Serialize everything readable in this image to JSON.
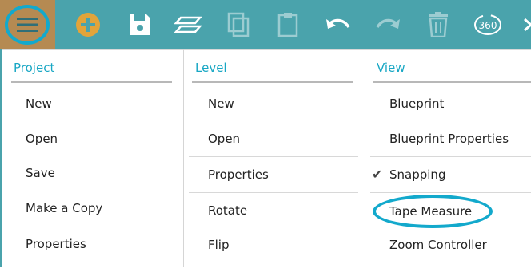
{
  "toolbar": {
    "buttons": [
      {
        "icon": "hamburger-menu-icon",
        "active": true
      },
      {
        "icon": "add-circle-icon"
      },
      {
        "icon": "save-icon"
      },
      {
        "icon": "layers-icon"
      },
      {
        "icon": "copy-icon"
      },
      {
        "icon": "paste-icon"
      },
      {
        "icon": "undo-icon"
      },
      {
        "icon": "redo-icon"
      },
      {
        "icon": "trash-icon"
      },
      {
        "icon": "view-360-icon",
        "label": "360"
      }
    ],
    "colors": {
      "bar": "#4aa3ac",
      "menu_cell": "#b58a52",
      "add_icon": "#e2a43a",
      "highlight_ring": "#13a9cc"
    }
  },
  "menu": {
    "project": {
      "header": "Project",
      "items": [
        "New",
        "Open",
        "Save",
        "Make a Copy",
        "Properties"
      ]
    },
    "level": {
      "header": "Level",
      "items": [
        "New",
        "Open",
        "Properties",
        "Rotate",
        "Flip"
      ]
    },
    "view": {
      "header": "View",
      "items": [
        "Blueprint",
        "Blueprint Properties",
        "Snapping",
        "Tape Measure",
        "Zoom Controller"
      ],
      "checked": "Snapping",
      "highlighted": "Tape Measure"
    },
    "check_glyph": "✔"
  }
}
